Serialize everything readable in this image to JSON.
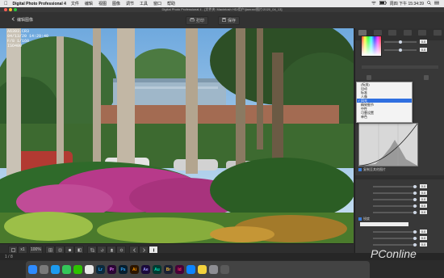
{
  "menubar": {
    "app_name": "Digital Photo Professional 4",
    "menus": [
      "文件",
      "编辑",
      "视图",
      "图像",
      "调节",
      "工具",
      "窗口",
      "帮助"
    ],
    "datetime": "周四 下午 15:34:39"
  },
  "window": {
    "title": "Digital Photo Professional 4 - [文件夹: Macintosh HD/用户/jianran/图片/2020_04_13]"
  },
  "toolbar": {
    "edit_label": "编辑图像",
    "print_label": "打印",
    "save_label": "保存"
  },
  "photo_info": {
    "file": "A6393.CR3",
    "datetime": "04/13/20 14:29:40",
    "exposure": "F/8 1/160",
    "iso": "ISO400"
  },
  "bottombar": {
    "zoom": "100%",
    "ratio": "x1"
  },
  "panel": {
    "picture_style_options": [
      "(标准)",
      "自动",
      "标准",
      "人像",
      "风光",
      "精致细节",
      "中性",
      "可靠设置",
      "单色"
    ],
    "selected_style": "风光",
    "values": {
      "brightness": "0.0",
      "contrast": "0.0",
      "highlight": "0.0",
      "shadow": "0.0",
      "color_tone": "0.0",
      "saturation": "0.0",
      "sharpness": "0.0",
      "fineness": "0.0",
      "threshold": "0.0"
    },
    "unsharp_label": "锐度",
    "sharpness_label": "锐度",
    "apply_label": "复制至其他图片"
  },
  "statusbar": {
    "count": "1 / 8"
  },
  "dock": {
    "apps": [
      "Finder",
      "Launchpad",
      "Safari",
      "Messages",
      "WeChat",
      "Chrome",
      "Lr",
      "Pr",
      "Ps",
      "Ai",
      "Ae",
      "Au",
      "Br",
      "Id",
      "App",
      "Photos",
      "Settings",
      "Trash"
    ]
  },
  "watermark": {
    "brand": "PConline"
  }
}
